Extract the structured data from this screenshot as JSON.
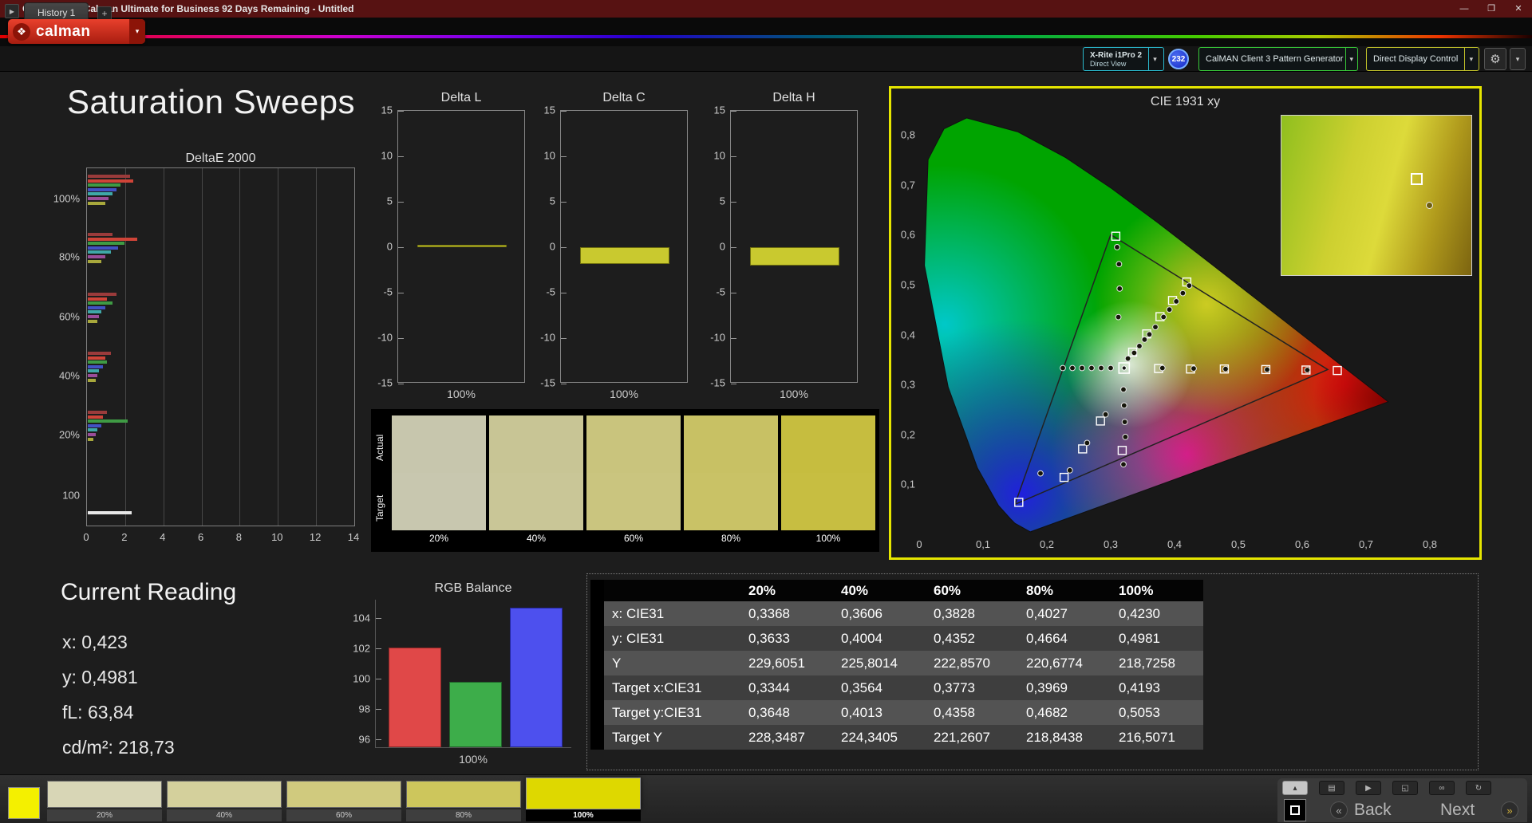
{
  "window": {
    "title": "Calman 2022 Calman Ultimate for Business 92 Days Remaining  - Untitled",
    "minimize": "—",
    "maximize": "❐",
    "close": "✕"
  },
  "toolbar": {
    "logo_text": "calman",
    "logo_emblem": "❖",
    "logo_caret": "▾",
    "meter_line1": "X-Rite i1Pro 2",
    "meter_line2": "Direct View",
    "badge": "232",
    "pattern_generator": "CalMAN Client 3 Pattern Generator",
    "display_control": "Direct Display Control",
    "gear": "⚙",
    "caret": "▾"
  },
  "tabs": {
    "expander": "▶",
    "history": "History 1",
    "add": "+"
  },
  "page_title": "Saturation Sweeps",
  "deltae": {
    "title": "DeltaE 2000",
    "xticks": [
      0,
      2,
      4,
      6,
      8,
      10,
      12,
      14
    ],
    "xmax": 14,
    "series_colors": [
      "#9b3b3b",
      "#cf4438",
      "#3f9b44",
      "#4252c4",
      "#3fa8a8",
      "#9a4d9a",
      "#a8a83c"
    ],
    "groups": [
      {
        "label": "100%",
        "values": [
          2.2,
          2.4,
          1.7,
          1.5,
          1.3,
          1.1,
          0.9
        ]
      },
      {
        "label": "80%",
        "values": [
          1.3,
          2.6,
          1.9,
          1.6,
          1.2,
          0.9,
          0.7
        ]
      },
      {
        "label": "60%",
        "values": [
          1.5,
          1.0,
          1.3,
          0.9,
          0.7,
          0.6,
          0.5
        ]
      },
      {
        "label": "40%",
        "values": [
          1.2,
          0.9,
          1.0,
          0.8,
          0.6,
          0.5,
          0.4
        ]
      },
      {
        "label": "20%",
        "values": [
          1.0,
          0.8,
          2.1,
          0.7,
          0.5,
          0.4,
          0.3
        ]
      },
      {
        "label": "100",
        "values": [
          2.3
        ],
        "colors": [
          "#e8e8e8"
        ]
      }
    ]
  },
  "delta_ticks": [
    15,
    10,
    5,
    0,
    -5,
    -10,
    -15
  ],
  "delta_charts": [
    {
      "title": "Delta L",
      "value": 0.3,
      "xlabel": "100%"
    },
    {
      "title": "Delta C",
      "value": -1.8,
      "xlabel": "100%"
    },
    {
      "title": "Delta H",
      "value": -2.0,
      "xlabel": "100%"
    }
  ],
  "saturation_swatches": {
    "row_labels": [
      "Actual",
      "Target"
    ],
    "columns": [
      {
        "label": "20%",
        "actual": "#c7c6ad",
        "target": "#c8c7af"
      },
      {
        "label": "40%",
        "actual": "#c8c595",
        "target": "#c9c697"
      },
      {
        "label": "60%",
        "actual": "#c9c47d",
        "target": "#cac57f"
      },
      {
        "label": "80%",
        "actual": "#c8c164",
        "target": "#c9c266"
      },
      {
        "label": "100%",
        "actual": "#c6bd3f",
        "target": "#c7be41"
      }
    ]
  },
  "cie": {
    "title": "CIE 1931 xy",
    "accent_border": "#e6e600",
    "xticks": [
      "0",
      "0,1",
      "0,2",
      "0,3",
      "0,4",
      "0,5",
      "0,6",
      "0,7",
      "0,8"
    ],
    "yticks": [
      "0,8",
      "0,7",
      "0,6",
      "0,5",
      "0,4",
      "0,3",
      "0,2",
      "0,1"
    ],
    "xmax": 0.87,
    "ymax": 0.84,
    "triangle": [
      [
        0.64,
        0.33
      ],
      [
        0.3,
        0.6
      ],
      [
        0.15,
        0.06
      ]
    ],
    "squares": [
      [
        0.3344,
        0.3648
      ],
      [
        0.3564,
        0.4013
      ],
      [
        0.3773,
        0.4358
      ],
      [
        0.3969,
        0.4682
      ],
      [
        0.4193,
        0.5053
      ],
      [
        0.308,
        0.597
      ],
      [
        0.375,
        0.332
      ],
      [
        0.425,
        0.331
      ],
      [
        0.478,
        0.331
      ],
      [
        0.543,
        0.33
      ],
      [
        0.606,
        0.329
      ],
      [
        0.655,
        0.328
      ],
      [
        0.284,
        0.227
      ],
      [
        0.256,
        0.171
      ],
      [
        0.227,
        0.114
      ],
      [
        0.156,
        0.064
      ],
      [
        0.318,
        0.168
      ]
    ],
    "circles": [
      [
        0.3368,
        0.3633
      ],
      [
        0.3606,
        0.4004
      ],
      [
        0.3828,
        0.4352
      ],
      [
        0.4027,
        0.4664
      ],
      [
        0.423,
        0.4981
      ],
      [
        0.327,
        0.352
      ],
      [
        0.345,
        0.377
      ],
      [
        0.353,
        0.39
      ],
      [
        0.37,
        0.415
      ],
      [
        0.392,
        0.45
      ],
      [
        0.413,
        0.483
      ],
      [
        0.312,
        0.435
      ],
      [
        0.314,
        0.492
      ],
      [
        0.313,
        0.541
      ],
      [
        0.31,
        0.575
      ],
      [
        0.225,
        0.333
      ],
      [
        0.24,
        0.333
      ],
      [
        0.255,
        0.333
      ],
      [
        0.27,
        0.333
      ],
      [
        0.285,
        0.333
      ],
      [
        0.3,
        0.333
      ],
      [
        0.381,
        0.333
      ],
      [
        0.43,
        0.332
      ],
      [
        0.48,
        0.331
      ],
      [
        0.545,
        0.33
      ],
      [
        0.608,
        0.329
      ],
      [
        0.292,
        0.24
      ],
      [
        0.263,
        0.183
      ],
      [
        0.236,
        0.128
      ],
      [
        0.19,
        0.122
      ],
      [
        0.32,
        0.29
      ],
      [
        0.321,
        0.258
      ],
      [
        0.322,
        0.225
      ],
      [
        0.323,
        0.195
      ],
      [
        0.32,
        0.14
      ]
    ],
    "current": [
      0.321,
      0.333
    ]
  },
  "reading": {
    "title": "Current Reading",
    "x": "x: 0,423",
    "y": "y: 0,4981",
    "fl": "fL: 63,84",
    "cdm2": "cd/m²: 218,73"
  },
  "rgb_balance": {
    "title": "RGB Balance",
    "yticks": [
      104,
      102,
      100,
      98,
      96
    ],
    "ymin": 95.4,
    "ymax": 105.2,
    "bars": [
      {
        "name": "red",
        "value": 102.0,
        "color": "#e04848",
        "border": "#8c2626"
      },
      {
        "name": "green",
        "value": 99.7,
        "color": "#3dad4a",
        "border": "#1f6329"
      },
      {
        "name": "blue",
        "value": 104.6,
        "color": "#4d50ee",
        "border": "#23269a"
      }
    ],
    "xlabel": "100%"
  },
  "table": {
    "columns": [
      "20%",
      "40%",
      "60%",
      "80%",
      "100%"
    ],
    "rows": [
      {
        "label": "x: CIE31",
        "values": [
          "0,3368",
          "0,3606",
          "0,3828",
          "0,4027",
          "0,4230"
        ]
      },
      {
        "label": "y: CIE31",
        "values": [
          "0,3633",
          "0,4004",
          "0,4352",
          "0,4664",
          "0,4981"
        ]
      },
      {
        "label": "Y",
        "values": [
          "229,6051",
          "225,8014",
          "222,8570",
          "220,6774",
          "218,7258"
        ]
      },
      {
        "label": "Target x:CIE31",
        "values": [
          "0,3344",
          "0,3564",
          "0,3773",
          "0,3969",
          "0,4193"
        ]
      },
      {
        "label": "Target y:CIE31",
        "values": [
          "0,3648",
          "0,4013",
          "0,4358",
          "0,4682",
          "0,5053"
        ]
      },
      {
        "label": "Target Y",
        "values": [
          "228,3487",
          "224,3405",
          "221,2607",
          "218,8438",
          "216,5071"
        ]
      }
    ]
  },
  "bottom": {
    "swatches": [
      {
        "label": "20%",
        "color": "#d8d6b6",
        "active": false
      },
      {
        "label": "40%",
        "color": "#d4d09c",
        "active": false
      },
      {
        "label": "60%",
        "color": "#d0ca7e",
        "active": false
      },
      {
        "label": "80%",
        "color": "#cdc65c",
        "active": false
      },
      {
        "label": "100%",
        "color": "#ded800",
        "active": true
      }
    ],
    "icons": [
      "▴",
      "▤",
      "▶",
      "◱",
      "∞",
      "↻"
    ],
    "back_chevron": "«",
    "back_label": "Back",
    "next_label": "Next",
    "next_chevron": "»"
  }
}
